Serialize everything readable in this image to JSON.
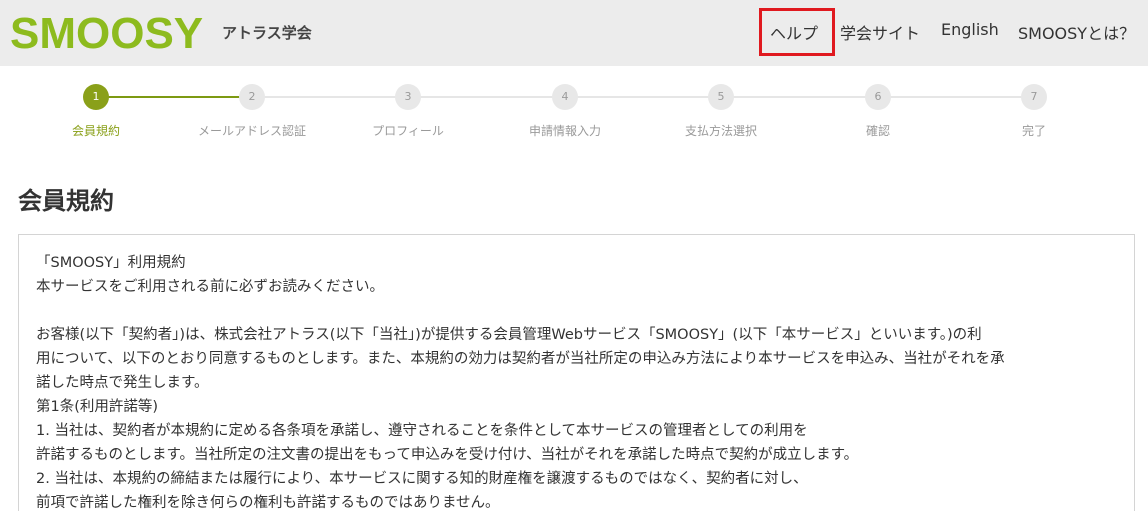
{
  "header": {
    "logo_text": "SMOOSY",
    "org_name": "アトラス学会",
    "nav": {
      "help": "ヘルプ",
      "society_site": "学会サイト",
      "english": "English",
      "about": "SMOOSYとは？"
    },
    "colors": {
      "logo_green": "#8dbb1e",
      "highlight": "#e0191f"
    }
  },
  "steps": [
    {
      "number": "1",
      "label": "会員規約",
      "active": true
    },
    {
      "number": "2",
      "label": "メールアドレス認証",
      "active": false
    },
    {
      "number": "3",
      "label": "プロフィール",
      "active": false
    },
    {
      "number": "4",
      "label": "申請情報入力",
      "active": false
    },
    {
      "number": "5",
      "label": "支払方法選択",
      "active": false
    },
    {
      "number": "6",
      "label": "確認",
      "active": false
    },
    {
      "number": "7",
      "label": "完了",
      "active": false
    }
  ],
  "page_title": "会員規約",
  "terms": {
    "text": "「SMOOSY」利用規約\n本サービスをご利用される前に必ずお読みください。\n\nお客様(以下「契約者」)は、株式会社アトラス(以下「当社」)が提供する会員管理Webサービス「SMOOSY」(以下「本サービス」といいます。)の利\n用について、以下のとおり同意するものとします。また、本規約の効力は契約者が当社所定の申込み方法により本サービスを申込み、当社がそれを承\n諾した時点で発生します。\n第1条(利用許諾等)\n1. 当社は、契約者が本規約に定める各条項を承諾し、遵守されることを条件として本サービスの管理者としての利用を\n許諾するものとします。当社所定の注文書の提出をもって申込みを受け付け、当社がそれを承諾した時点で契約が成立します。\n2. 当社は、本規約の締結または履行により、本サービスに関する知的財産権を譲渡するものではなく、契約者に対し、\n前項で許諾した権利を除き何らの権利も許諾するものではありません。"
  }
}
